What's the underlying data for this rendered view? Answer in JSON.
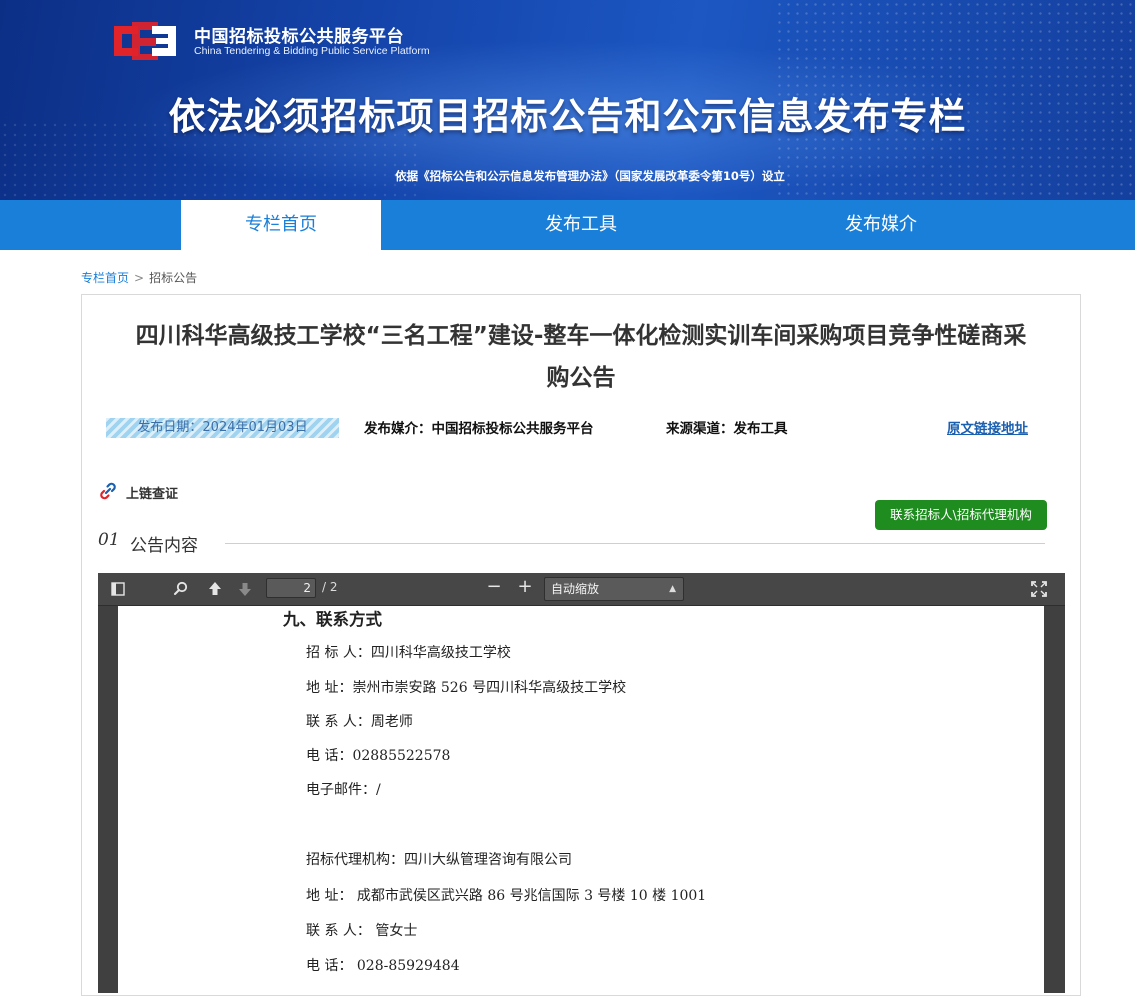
{
  "header": {
    "logo_cn": "中国招标投标公共服务平台",
    "logo_en": "China Tendering & Bidding Public Service Platform",
    "title": "依法必须招标项目招标公告和公示信息发布专栏",
    "subtitle": "依据《招标公告和公示信息发布管理办法》（国家发展改革委令第10号）设立",
    "logo_colors": {
      "red": "#e1232a",
      "white": "#ffffff"
    }
  },
  "nav": {
    "items": [
      {
        "label": "专栏首页",
        "active": true
      },
      {
        "label": "发布工具",
        "active": false
      },
      {
        "label": "发布媒介",
        "active": false
      }
    ]
  },
  "breadcrumb": {
    "home": "专栏首页",
    "current": "招标公告",
    "separator": ">"
  },
  "article": {
    "title_line1": "四川科华高级技工学校“三名工程”建设-整车一体化检测实训车间采购项目竞争性磋商采",
    "title_line2": "购公告",
    "publish_date": "发布日期：2024年01月03日",
    "media": "发布媒介：中国招标投标公共服务平台",
    "source": "来源渠道：发布工具",
    "original_link": "原文链接地址",
    "chain_label": "上链查证",
    "contact_button": "联系招标人\\招标代理机构",
    "section_num": "01",
    "section_label": "公告内容"
  },
  "viewer": {
    "page_current": "2",
    "page_total": "/ 2",
    "zoom_label": "自动缩放",
    "zoom_minus": "−",
    "zoom_plus": "+",
    "icons": [
      "sidebar-toggle-icon",
      "search-icon",
      "page-up-icon",
      "page-down-icon",
      "fullscreen-icon"
    ]
  },
  "pdf": {
    "heading": "九、联系方式",
    "lines": [
      "招  标  人：四川科华高级技工学校",
      "地      址：崇州市崇安路 526 号四川科华高级技工学校",
      "联  系  人：周老师",
      "电      话：02885522578",
      "电子邮件：/",
      "",
      "招标代理机构：四川大纵管理咨询有限公司",
      "地      址：  成都市武侯区武兴路 86 号兆信国际 3 号楼 10 楼 1001",
      "联  系  人：  管女士",
      "电      话：  028-85929484"
    ]
  },
  "colors": {
    "nav_blue": "#1a7fd8",
    "button_green": "#1e8c1e",
    "viewer_dark": "#404040"
  }
}
